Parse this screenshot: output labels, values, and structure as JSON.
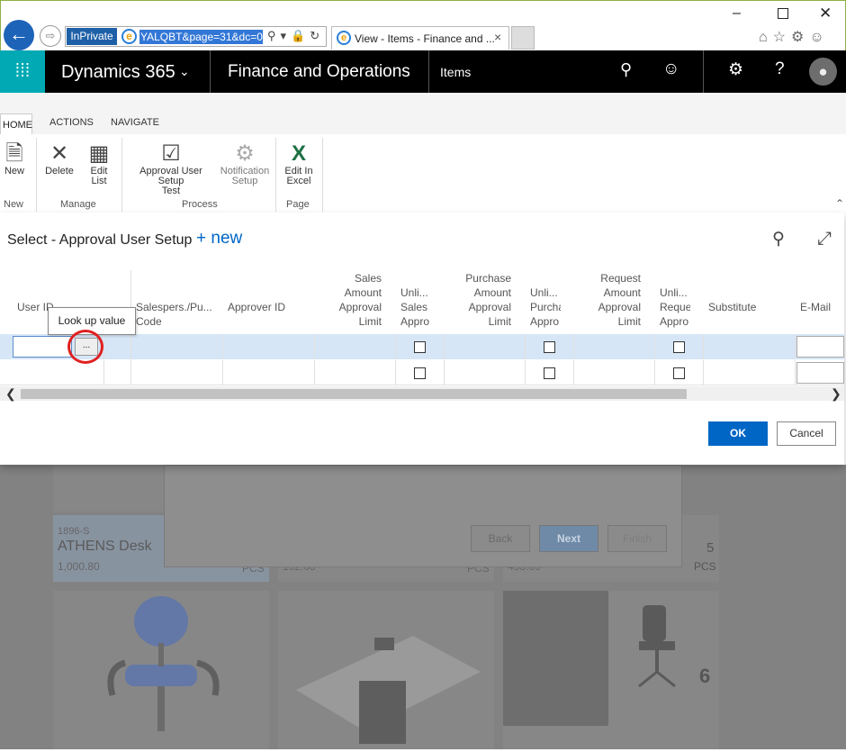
{
  "browser": {
    "inprivate_label": "InPrivate",
    "url": "YALQBT&page=31&dc=0",
    "tab_title": "View - Items - Finance and ...",
    "tab_close": "×"
  },
  "nav": {
    "brand": "Dynamics 365",
    "app_title": "Finance and Operations",
    "page": "Items"
  },
  "ribbon": {
    "tabs": [
      "HOME",
      "ACTIONS",
      "NAVIGATE"
    ],
    "buttons": {
      "new": "New",
      "delete": "Delete",
      "edit_list_1": "Edit",
      "edit_list_2": "List",
      "approval_1": "Approval User Setup",
      "approval_2": "Test",
      "notif_1": "Notification",
      "notif_2": "Setup",
      "excel_1": "Edit In",
      "excel_2": "Excel"
    },
    "groups": [
      "New",
      "Manage",
      "Process",
      "Page"
    ]
  },
  "dialog": {
    "title": "Select - Approval User Setup",
    "new_label": "+ new",
    "columns": {
      "user_id": "User ID",
      "salesperson_1": "Salespers./Pu...",
      "salesperson_2": "Code",
      "approver_id": "Approver ID",
      "sales_amt": [
        "Sales",
        "Amount",
        "Approval",
        "Limit"
      ],
      "unl_sales": [
        "Unli...",
        "Sales",
        "Appro"
      ],
      "purch_amt": [
        "Purchase",
        "Amount",
        "Approval",
        "Limit"
      ],
      "unl_purch": [
        "Unli...",
        "Purcha",
        "Appro"
      ],
      "req_amt": [
        "Request",
        "Amount",
        "Approval",
        "Limit"
      ],
      "unl_req": [
        "Unli...",
        "Reque",
        "Appro"
      ],
      "substitute": "Substitute",
      "email": "E-Mail"
    },
    "tooltip": "Look up value",
    "lookup_label": "...",
    "ok": "OK",
    "cancel": "Cancel"
  },
  "background": {
    "item_number": "1896-S",
    "item_name": "ATHENS Desk",
    "item_price": "1,000.80",
    "unit_1": "PCS",
    "price_2": "192.00",
    "unit_2": "PCS",
    "price_3": "433.00",
    "count_right": "5",
    "unit_right": "PCS",
    "count_six": "6",
    "wizard_back": "Back",
    "wizard_next": "Next",
    "wizard_finish": "Finish"
  }
}
